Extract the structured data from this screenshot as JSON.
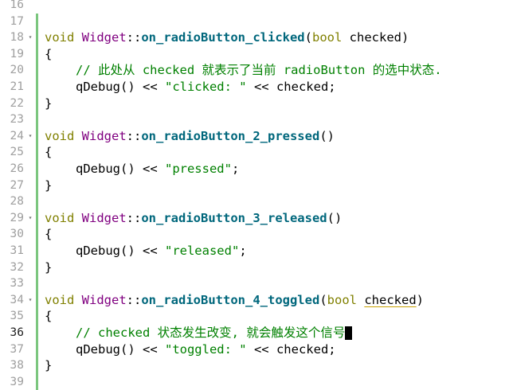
{
  "editor": {
    "line_numbers": [
      "16",
      "17",
      "18",
      "19",
      "20",
      "21",
      "22",
      "23",
      "24",
      "25",
      "26",
      "27",
      "28",
      "29",
      "30",
      "31",
      "32",
      "33",
      "34",
      "35",
      "36",
      "37",
      "38",
      "39"
    ],
    "current_line_number": "36",
    "fold_marker": "▾",
    "code_lines": [
      {
        "no": "16",
        "tokens": []
      },
      {
        "no": "17",
        "tokens": []
      },
      {
        "no": "18",
        "fold": true,
        "tokens": [
          {
            "t": "void",
            "c": "kw"
          },
          {
            "t": " "
          },
          {
            "t": "Widget",
            "c": "cls"
          },
          {
            "t": "::"
          },
          {
            "t": "on_radioButton_clicked",
            "c": "fn"
          },
          {
            "t": "("
          },
          {
            "t": "bool",
            "c": "kw"
          },
          {
            "t": " checked)"
          }
        ]
      },
      {
        "no": "19",
        "tokens": [
          {
            "t": "{"
          }
        ]
      },
      {
        "no": "20",
        "indent": 1,
        "tokens": [
          {
            "t": "// 此处从 checked 就表示了当前 radioButton 的选中状态.",
            "c": "cmt"
          }
        ]
      },
      {
        "no": "21",
        "indent": 1,
        "tokens": [
          {
            "t": "qDebug() << "
          },
          {
            "t": "\"clicked: \"",
            "c": "str"
          },
          {
            "t": " << checked;"
          }
        ]
      },
      {
        "no": "22",
        "tokens": [
          {
            "t": "}"
          }
        ]
      },
      {
        "no": "23",
        "tokens": []
      },
      {
        "no": "24",
        "fold": true,
        "tokens": [
          {
            "t": "void",
            "c": "kw"
          },
          {
            "t": " "
          },
          {
            "t": "Widget",
            "c": "cls"
          },
          {
            "t": "::"
          },
          {
            "t": "on_radioButton_2_pressed",
            "c": "fn"
          },
          {
            "t": "()"
          }
        ]
      },
      {
        "no": "25",
        "tokens": [
          {
            "t": "{"
          }
        ]
      },
      {
        "no": "26",
        "indent": 1,
        "tokens": [
          {
            "t": "qDebug() << "
          },
          {
            "t": "\"pressed\"",
            "c": "str"
          },
          {
            "t": ";"
          }
        ]
      },
      {
        "no": "27",
        "tokens": [
          {
            "t": "}"
          }
        ]
      },
      {
        "no": "28",
        "tokens": []
      },
      {
        "no": "29",
        "fold": true,
        "tokens": [
          {
            "t": "void",
            "c": "kw"
          },
          {
            "t": " "
          },
          {
            "t": "Widget",
            "c": "cls"
          },
          {
            "t": "::"
          },
          {
            "t": "on_radioButton_3_released",
            "c": "fn"
          },
          {
            "t": "()"
          }
        ]
      },
      {
        "no": "30",
        "tokens": [
          {
            "t": "{"
          }
        ]
      },
      {
        "no": "31",
        "indent": 1,
        "tokens": [
          {
            "t": "qDebug() << "
          },
          {
            "t": "\"released\"",
            "c": "str"
          },
          {
            "t": ";"
          }
        ]
      },
      {
        "no": "32",
        "tokens": [
          {
            "t": "}"
          }
        ]
      },
      {
        "no": "33",
        "tokens": []
      },
      {
        "no": "34",
        "fold": true,
        "tokens": [
          {
            "t": "void",
            "c": "kw"
          },
          {
            "t": " "
          },
          {
            "t": "Widget",
            "c": "cls"
          },
          {
            "t": "::"
          },
          {
            "t": "on_radioButton_4_toggled",
            "c": "fn"
          },
          {
            "t": "("
          },
          {
            "t": "bool",
            "c": "kw"
          },
          {
            "t": " "
          },
          {
            "t": "checked",
            "c": "squig"
          },
          {
            "t": ")"
          }
        ]
      },
      {
        "no": "35",
        "tokens": [
          {
            "t": "{"
          }
        ]
      },
      {
        "no": "36",
        "indent": 1,
        "cursor": true,
        "tokens": [
          {
            "t": "// checked 状态发生改变, 就会触发这个信号",
            "c": "cmt"
          },
          {
            "t": ".",
            "c": "cmt"
          }
        ]
      },
      {
        "no": "37",
        "indent": 1,
        "tokens": [
          {
            "t": "qDebug() << "
          },
          {
            "t": "\"toggled: \"",
            "c": "str"
          },
          {
            "t": " << checked;"
          }
        ]
      },
      {
        "no": "38",
        "tokens": [
          {
            "t": "}"
          }
        ]
      },
      {
        "no": "39",
        "tokens": []
      }
    ]
  },
  "colors": {
    "keyword": "#808000",
    "class_name": "#800080",
    "function_name": "#00677c",
    "string": "#008000",
    "comment": "#008000",
    "line_number": "#9f9f9f",
    "change_bar": "#7bc67e"
  },
  "icons": {
    "fold": "chevron-down-icon"
  }
}
